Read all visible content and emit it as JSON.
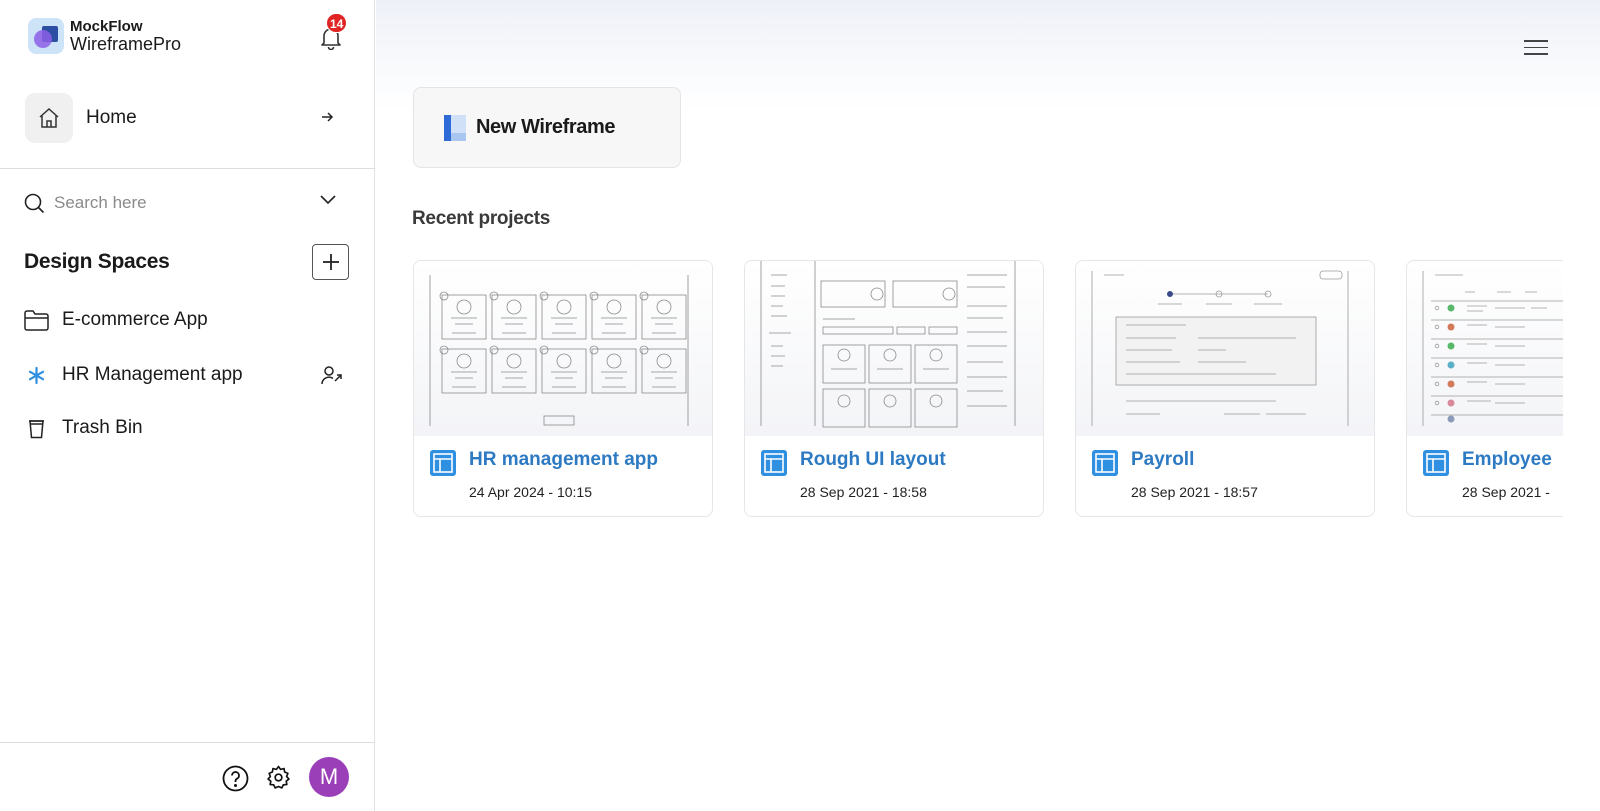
{
  "brand": {
    "name": "MockFlow",
    "product": "WireframePro"
  },
  "notifications": {
    "count": "14"
  },
  "nav": {
    "home_label": "Home"
  },
  "search": {
    "placeholder": "Search here"
  },
  "design_spaces": {
    "title": "Design Spaces",
    "items": [
      {
        "label": "E-commerce App",
        "icon": "folder-icon"
      },
      {
        "label": "HR Management app",
        "icon": "asterisk-icon"
      },
      {
        "label": "Trash Bin",
        "icon": "trash-icon"
      }
    ]
  },
  "user": {
    "avatar_initial": "M"
  },
  "main": {
    "new_wireframe_label": "New Wireframe",
    "recent_title": "Recent projects",
    "projects": [
      {
        "name": "HR management app",
        "date": "24 Apr 2024 - 10:15"
      },
      {
        "name": "Rough UI layout",
        "date": "28 Sep 2021 - 18:58"
      },
      {
        "name": "Payroll",
        "date": "28 Sep 2021 - 18:57"
      },
      {
        "name": "Employee",
        "date": "28 Sep 2021 - "
      }
    ]
  },
  "colors": {
    "accent": "#2d7ac3",
    "badge": "#e02424",
    "avatar": "#9b3fb8",
    "asterisk": "#2f8fe0"
  }
}
